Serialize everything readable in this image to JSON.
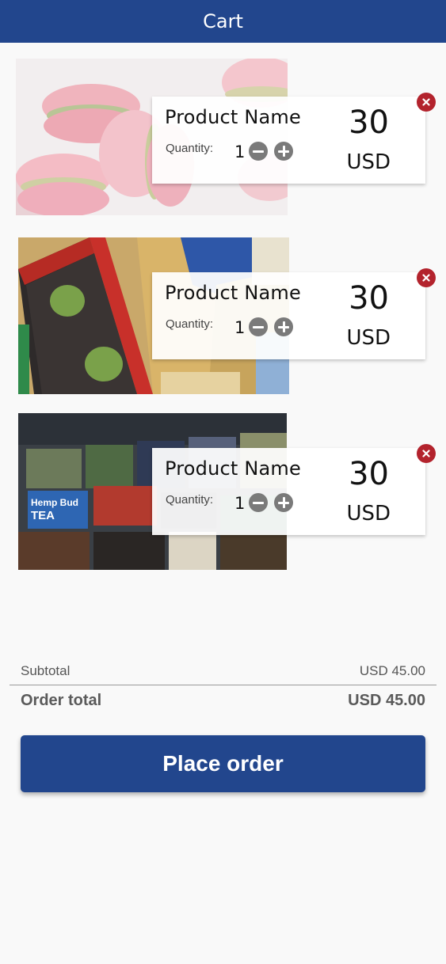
{
  "header": {
    "title": "Cart"
  },
  "cart": {
    "items": [
      {
        "image": "macarons-photo",
        "name": "Product Name",
        "quantity_label": "Quantity:",
        "quantity": "1",
        "price": "30",
        "currency": "USD"
      },
      {
        "image": "packaged-food-photo",
        "name": "Product Name",
        "quantity_label": "Quantity:",
        "quantity": "1",
        "price": "30",
        "currency": "USD"
      },
      {
        "image": "tea-boxes-photo",
        "name": "Product Name",
        "quantity_label": "Quantity:",
        "quantity": "1",
        "price": "30",
        "currency": "USD"
      }
    ]
  },
  "summary": {
    "subtotal_label": "Subtotal",
    "subtotal_value": "USD 45.00",
    "total_label": "Order total",
    "total_value": "USD 45.00"
  },
  "actions": {
    "place_order_label": "Place order"
  },
  "colors": {
    "header_bg": "#22468d",
    "primary_button": "#22468d",
    "remove_button": "#b3232d",
    "stepper_button": "#7a7a7a",
    "page_bg": "#f9f9f9"
  },
  "icons": {
    "remove": "close-icon",
    "decrement": "minus-icon",
    "increment": "plus-icon"
  }
}
